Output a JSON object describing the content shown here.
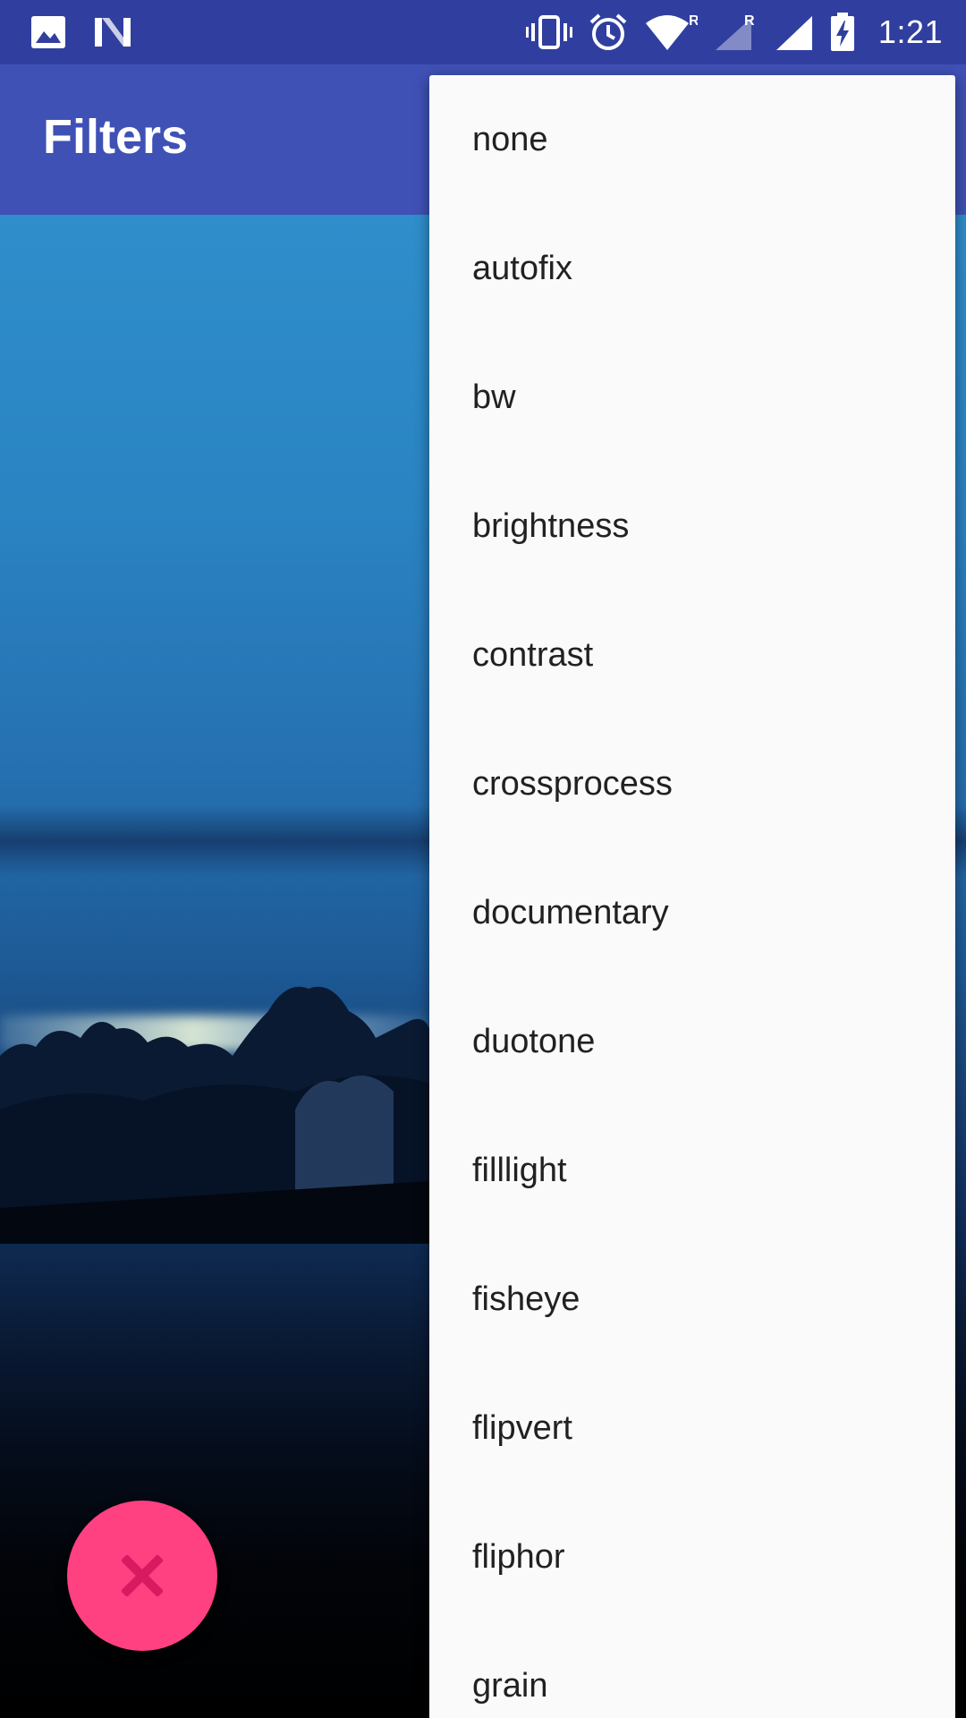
{
  "status_bar": {
    "time": "1:21",
    "left_icons": [
      "gallery-icon",
      "n-logo-icon"
    ],
    "right_icons": [
      "vibrate-icon",
      "alarm-icon",
      "wifi-icon",
      "signal-r-icon",
      "signal-r-icon",
      "battery-charging-icon"
    ],
    "roaming_label_1": "R",
    "roaming_label_2": "R"
  },
  "app_bar": {
    "title": "Filters"
  },
  "menu": {
    "items": [
      {
        "label": "none"
      },
      {
        "label": "autofix"
      },
      {
        "label": "bw"
      },
      {
        "label": "brightness"
      },
      {
        "label": "contrast"
      },
      {
        "label": "crossprocess"
      },
      {
        "label": "documentary"
      },
      {
        "label": "duotone"
      },
      {
        "label": "filllight"
      },
      {
        "label": "fisheye"
      },
      {
        "label": "flipvert"
      },
      {
        "label": "fliphor"
      },
      {
        "label": "grain"
      }
    ]
  },
  "fab": {
    "icon": "close-icon",
    "color": "#ff4081",
    "glyph_color": "#d81b60"
  },
  "colors": {
    "status_bar": "#303f9f",
    "app_bar": "#3f51b5",
    "menu_background": "#fafafa",
    "menu_text": "#212121"
  }
}
